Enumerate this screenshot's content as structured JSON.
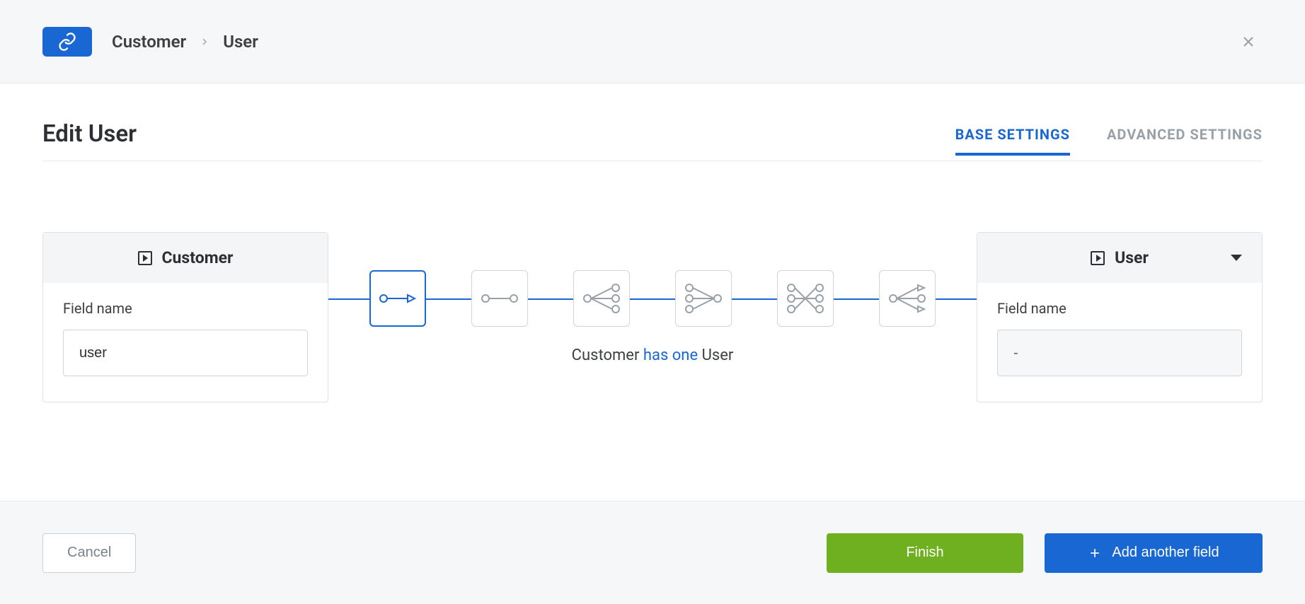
{
  "breadcrumb": {
    "item1": "Customer",
    "item2": "User"
  },
  "page": {
    "title": "Edit User"
  },
  "tabs": {
    "base": "BASE SETTINGS",
    "advanced": "ADVANCED SETTINGS"
  },
  "leftCard": {
    "title": "Customer",
    "fieldLabel": "Field name",
    "fieldValue": "user"
  },
  "rightCard": {
    "title": "User",
    "fieldLabel": "Field name",
    "fieldValue": "-"
  },
  "relation": {
    "captionPrefix": "Customer ",
    "captionHighlight": "has one",
    "captionSuffix": " User",
    "types": [
      "has-one",
      "has-and-belongs-to-one",
      "has-many",
      "belongs-to-many",
      "many-to-many",
      "polymorphic"
    ]
  },
  "footer": {
    "cancel": "Cancel",
    "finish": "Finish",
    "addAnother": "Add another field"
  },
  "colors": {
    "primary": "#1967d2",
    "success": "#6eb01f"
  }
}
